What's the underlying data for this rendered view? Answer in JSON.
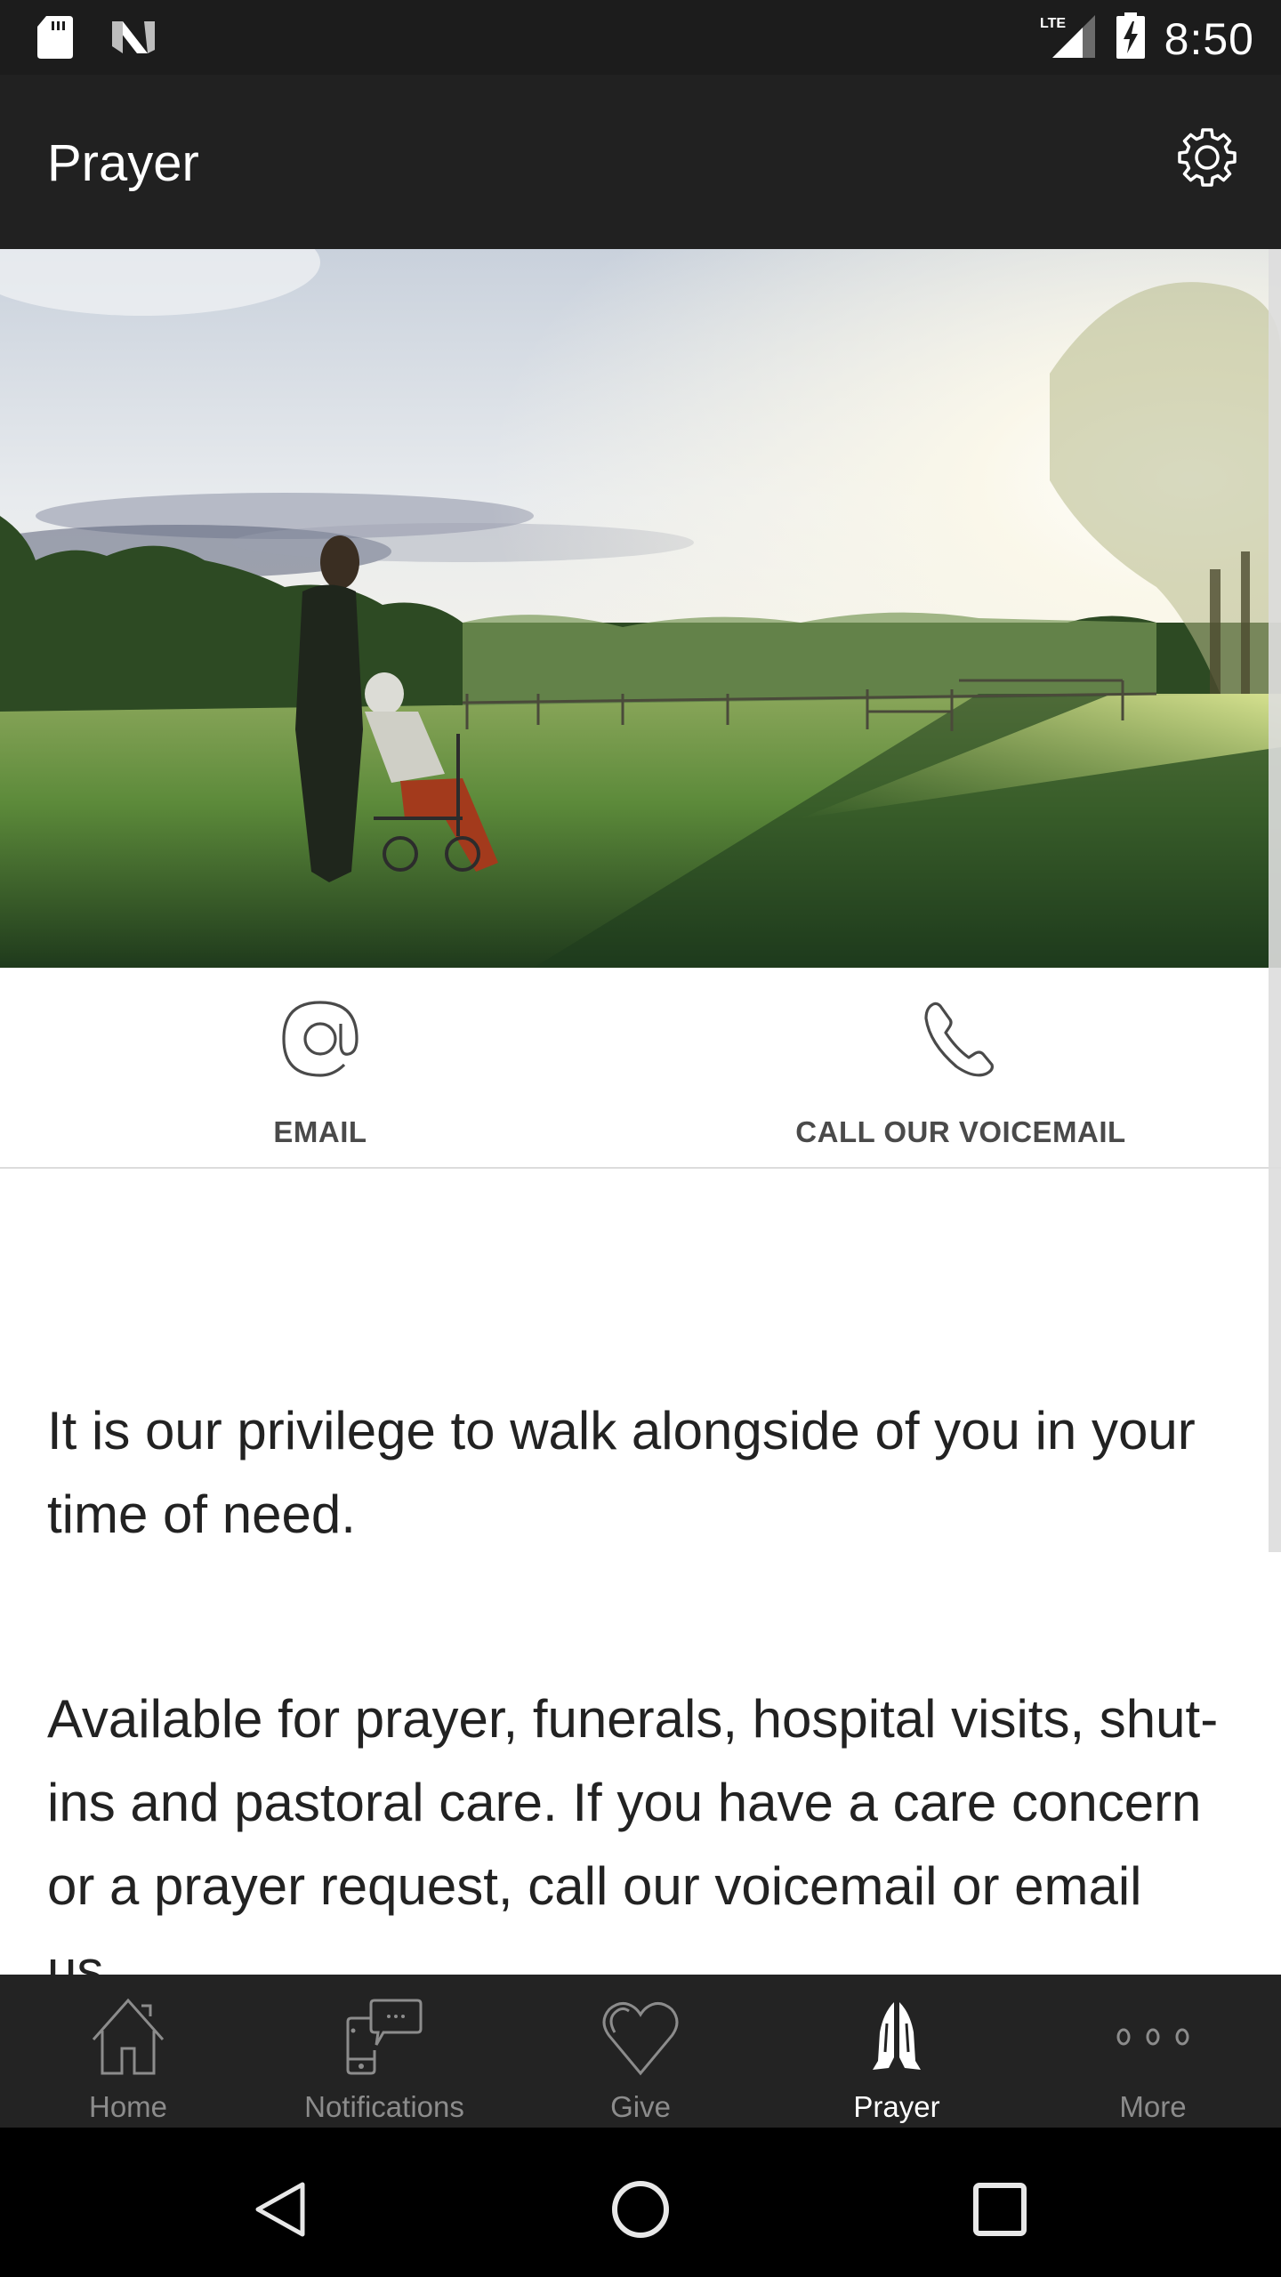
{
  "status_bar": {
    "left_icons": [
      "sd-card-icon",
      "n-notification-icon"
    ],
    "network": "LTE",
    "right_icons": [
      "lte-signal-icon",
      "battery-charging-icon"
    ],
    "time": "8:50"
  },
  "app_bar": {
    "title": "Prayer",
    "settings_icon": "gear-icon"
  },
  "hero": {
    "description": "Person pushing an elderly woman in a wheelchair across a sunlit grassy field at sunset"
  },
  "actions": [
    {
      "label": "EMAIL",
      "icon": "at-sign-icon"
    },
    {
      "label": "CALL OUR VOICEMAIL",
      "icon": "phone-icon"
    }
  ],
  "content": {
    "paragraphs": [
      "It is our privilege to walk alongside of you in your time of need.",
      "Available for prayer, funerals, hospital visits, shut-ins and pastoral care. If you have a care concern or a prayer request, call our voicemail or email us."
    ]
  },
  "bottom_nav": {
    "items": [
      {
        "label": "Home",
        "icon": "home-icon",
        "active": false
      },
      {
        "label": "Notifications",
        "icon": "notifications-phone-icon",
        "active": false
      },
      {
        "label": "Give",
        "icon": "heart-icon",
        "active": false
      },
      {
        "label": "Prayer",
        "icon": "praying-hands-icon",
        "active": true
      },
      {
        "label": "More",
        "icon": "more-dots-icon",
        "active": false
      }
    ]
  },
  "system_nav": {
    "buttons": [
      "back-icon",
      "home-circle-icon",
      "recents-square-icon"
    ]
  },
  "colors": {
    "app_bar": "#212121",
    "status_bar": "#1c1c1c",
    "bottom_nav": "#232323",
    "nav_inactive": "#8c8c8c",
    "nav_active": "#ffffff",
    "action_text": "#4a4a4a",
    "body_text": "#222222"
  }
}
